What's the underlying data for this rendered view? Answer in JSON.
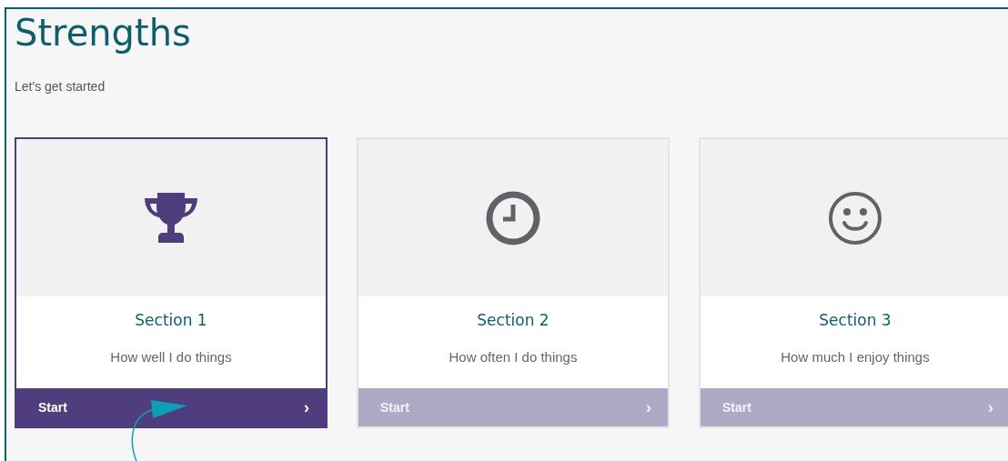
{
  "page": {
    "title": "Strengths",
    "subtitle": "Let's get started"
  },
  "cards": [
    {
      "kind": "trophy",
      "title": "Section 1",
      "description": "How well I do things",
      "button": "Start",
      "chevron": "›",
      "active": true
    },
    {
      "kind": "clock",
      "title": "Section 2",
      "description": "How often I do things",
      "button": "Start",
      "chevron": "›",
      "active": false
    },
    {
      "kind": "smiley",
      "title": "Section 3",
      "description": "How much I enjoy things",
      "button": "Start",
      "chevron": "›",
      "active": false
    }
  ]
}
